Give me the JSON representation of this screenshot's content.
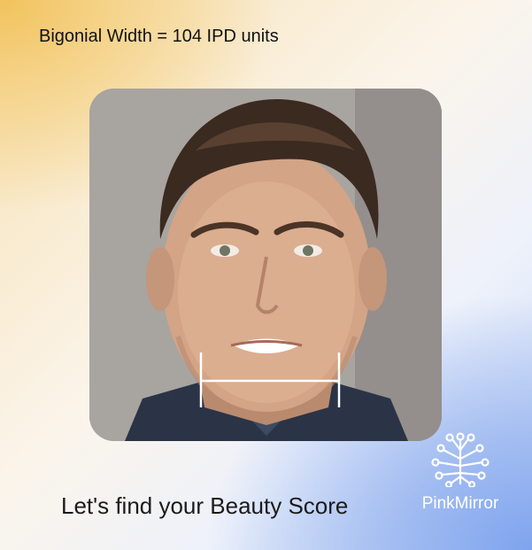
{
  "measurement": {
    "label": "Bigonial Width = 104 IPD units"
  },
  "photo": {
    "overlay_color": "#ffffff"
  },
  "tagline": "Let's find your Beauty Score",
  "brand": {
    "name": "PinkMirror",
    "logo_icon": "circuit-tree-icon",
    "color": "#ffffff"
  }
}
